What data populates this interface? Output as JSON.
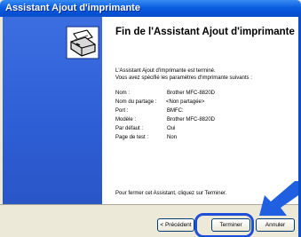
{
  "window": {
    "title": "Assistant Ajout d'imprimante"
  },
  "page": {
    "heading": "Fin de l'Assistant Ajout d'imprimante",
    "intro_line1": "L'Assistant Ajout d'imprimante est terminé.",
    "intro_line2": "Vous avez spécifié les paramètres d'imprimante suivants :",
    "properties": [
      {
        "key": "Nom :",
        "value": "Brother MFC-8820D"
      },
      {
        "key": "Nom du partage :",
        "value": "<Non partagée>"
      },
      {
        "key": "Port :",
        "value": "BMFC:"
      },
      {
        "key": "Modèle :",
        "value": "Brother MFC-8820D"
      },
      {
        "key": "Par défaut :",
        "value": "Oui"
      },
      {
        "key": "Page de test :",
        "value": "Non"
      }
    ],
    "closing": "Pour fermer cet Assistant, cliquez sur Terminer."
  },
  "buttons": {
    "prev": "< Précédent",
    "finish": "Terminer",
    "cancel": "Annuler"
  },
  "icons": {
    "printer": "printer-icon",
    "arrow": "arrow-icon"
  },
  "colors": {
    "title_bar": "#0a5ee0",
    "side_panel": "#2e5fd6",
    "highlight": "#1f4ed8"
  }
}
